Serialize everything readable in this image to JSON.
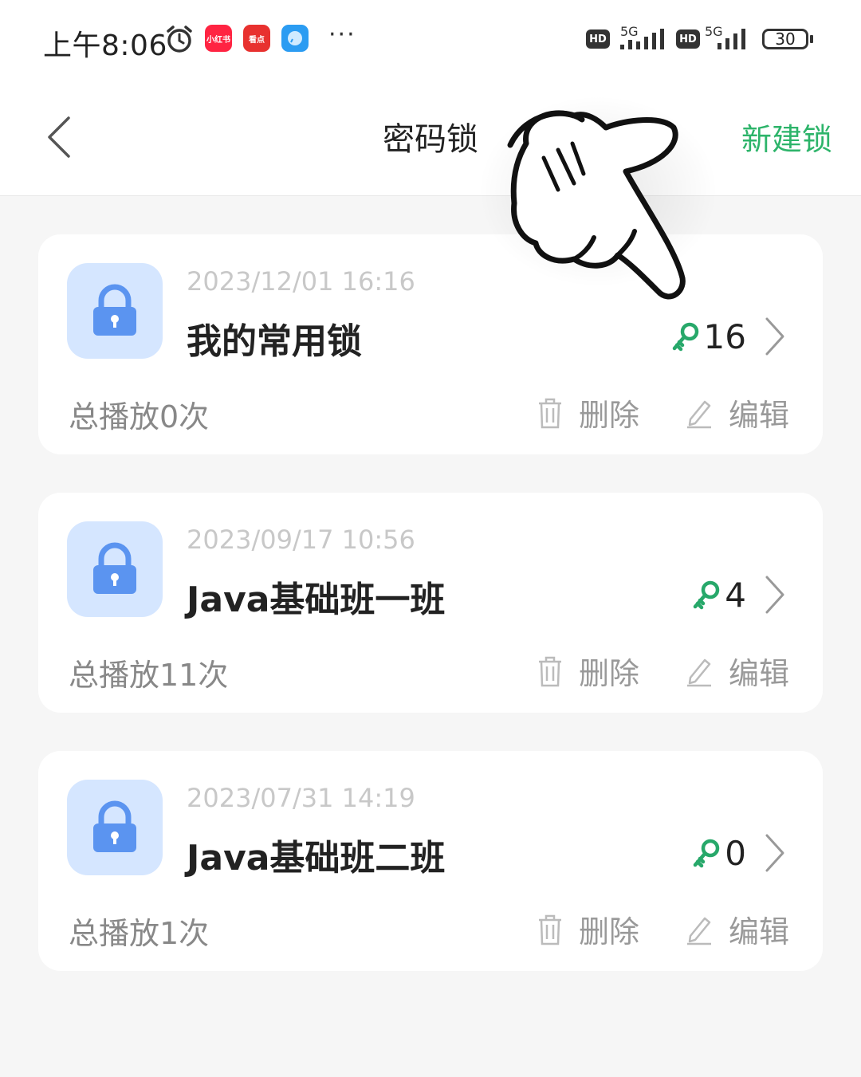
{
  "status_bar": {
    "time": "上午8:06",
    "apps": [
      {
        "name": "xiaohongshu-app-icon",
        "text": "小红书",
        "color": "#ff2442"
      },
      {
        "name": "kandian-app-icon",
        "text": "看点",
        "color": "#e8312f"
      },
      {
        "name": "messenger-app-icon",
        "text": "",
        "color": "#2b9cf2"
      }
    ],
    "more": "···",
    "hd": "HD",
    "network": "5G",
    "battery": "30"
  },
  "nav": {
    "title": "密码锁",
    "action": "新建锁"
  },
  "colors": {
    "accent_green": "#2db46a",
    "lock_tile_bg": "#d5e6ff",
    "lock_blue": "#5b94f0",
    "key_green": "#27a86a"
  },
  "actions": {
    "delete": "删除",
    "edit": "编辑"
  },
  "locks": [
    {
      "date": "2023/12/01 16:16",
      "name": "我的常用锁",
      "key_count": "16",
      "plays": "总播放0次"
    },
    {
      "date": "2023/09/17 10:56",
      "name": "Java基础班一班",
      "key_count": "4",
      "plays": "总播放11次"
    },
    {
      "date": "2023/07/31 14:19",
      "name": "Java基础班二班",
      "key_count": "0",
      "plays": "总播放1次"
    }
  ]
}
